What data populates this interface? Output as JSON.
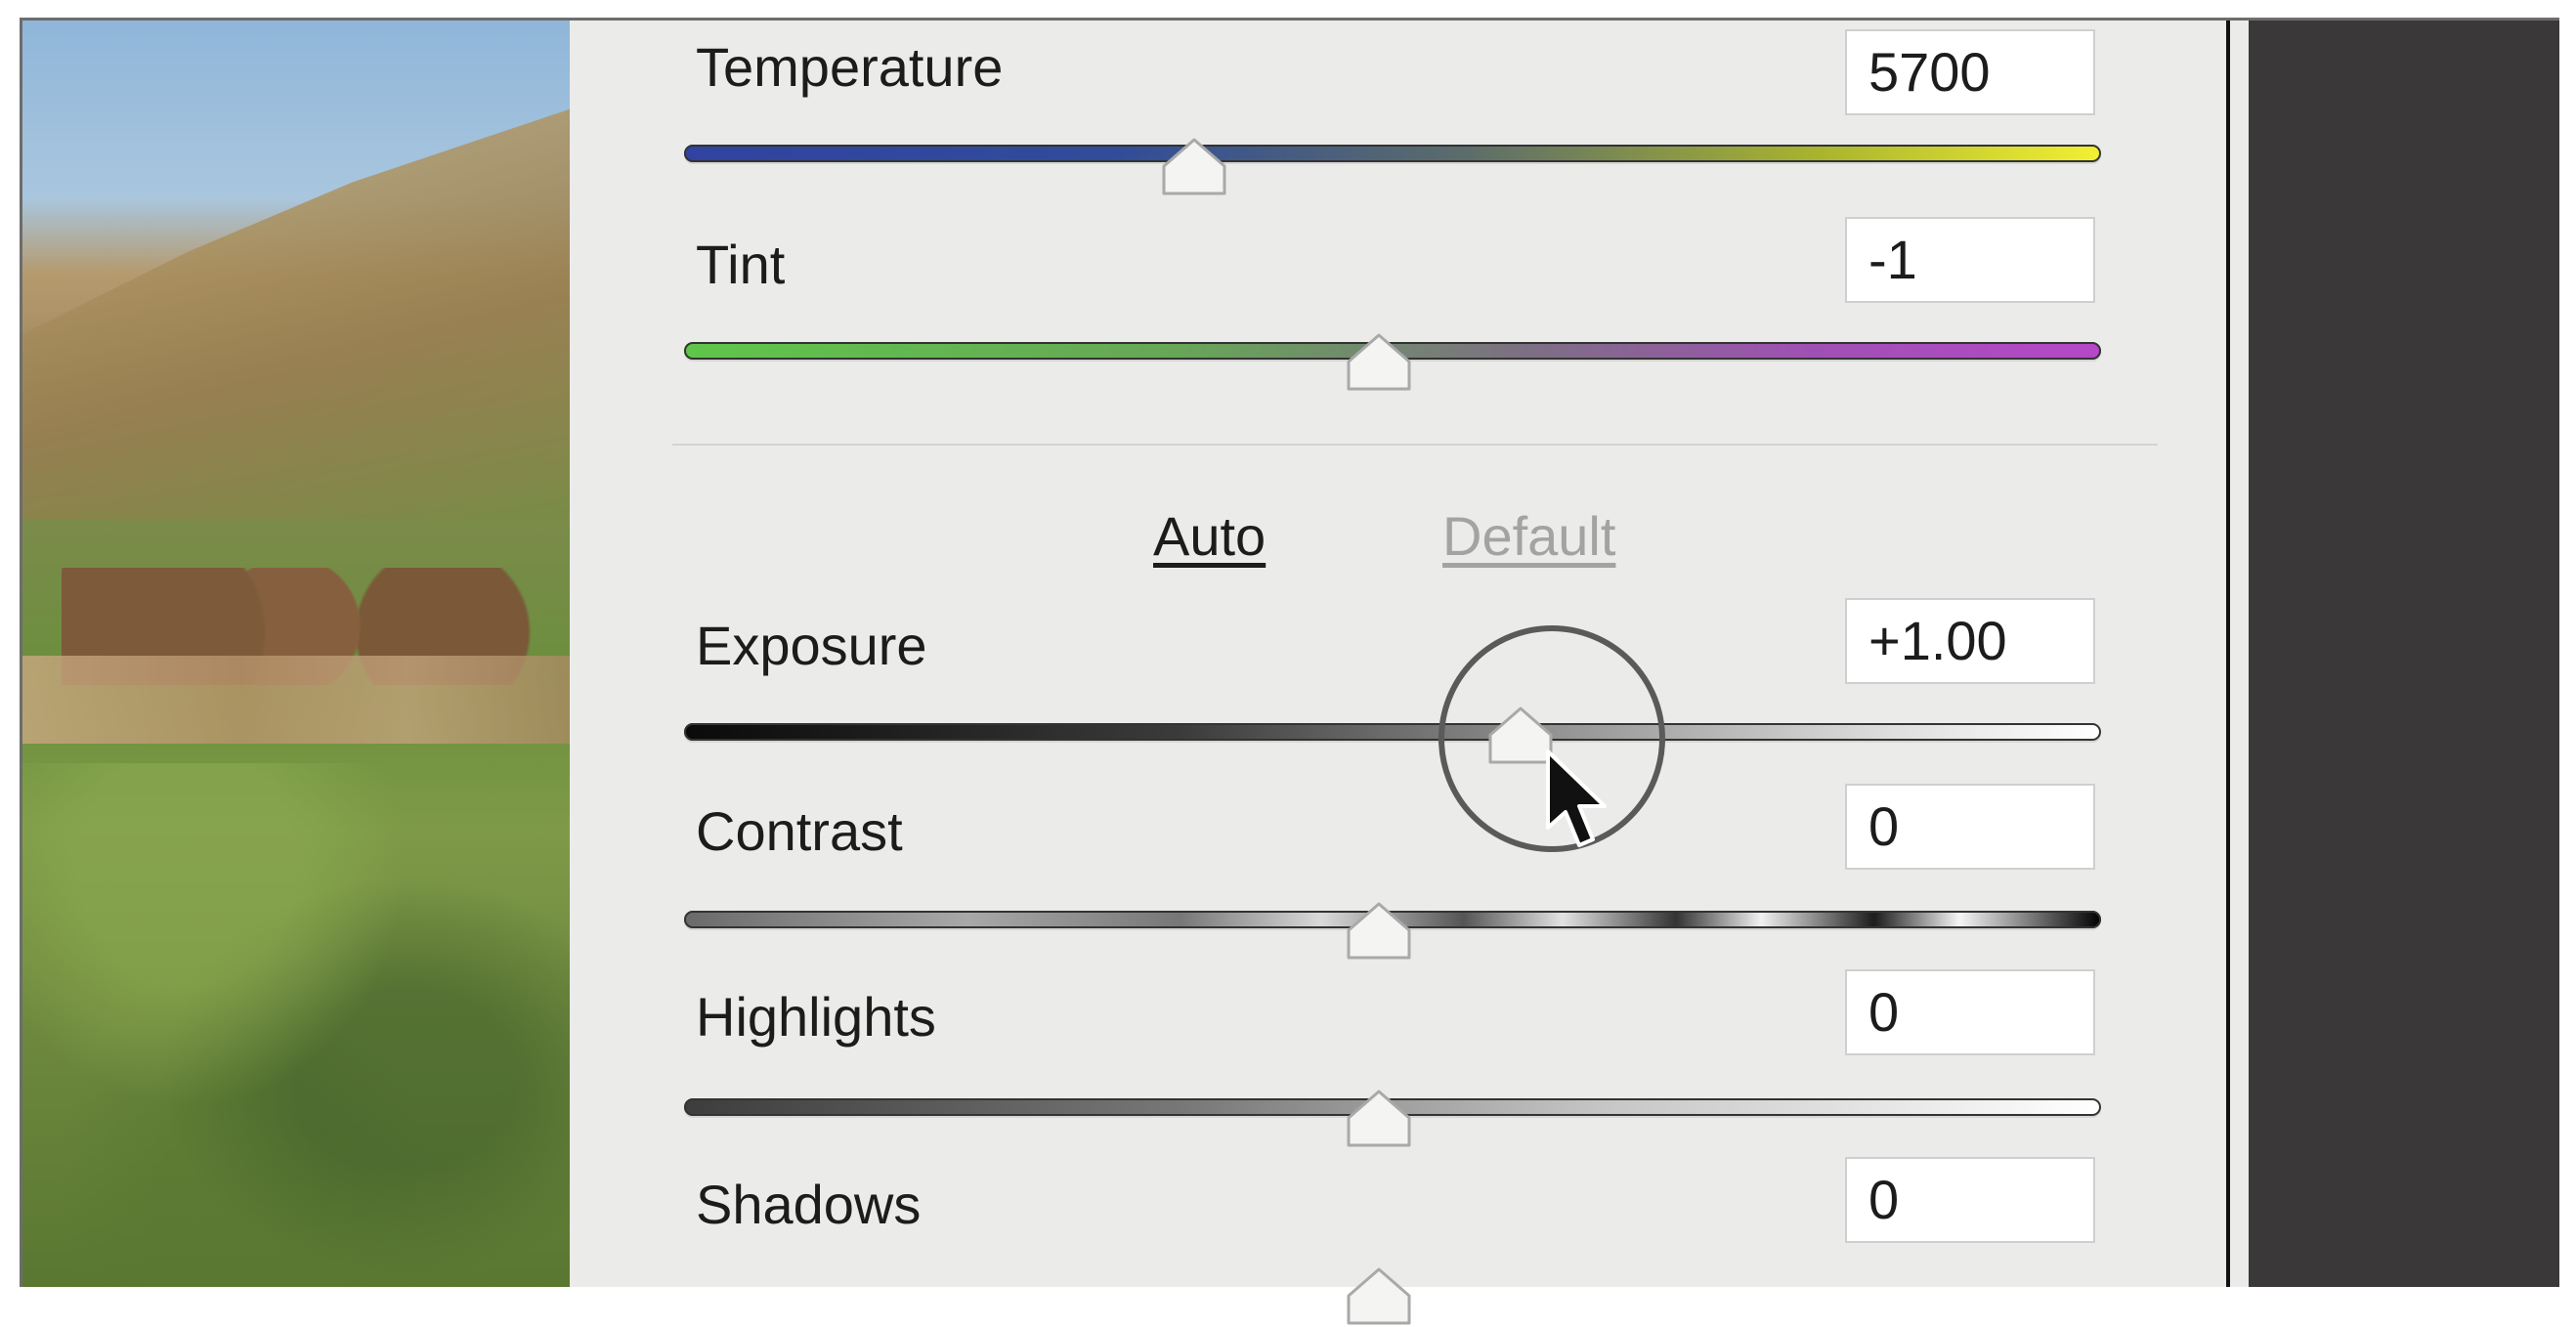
{
  "panel": {
    "temperature": {
      "label": "Temperature",
      "value": "5700",
      "slider_position": 0.36
    },
    "tint": {
      "label": "Tint",
      "value": "-1",
      "slider_position": 0.49
    },
    "buttons": {
      "auto": "Auto",
      "default": "Default"
    },
    "exposure": {
      "label": "Exposure",
      "value": "+1.00",
      "slider_position": 0.59
    },
    "contrast": {
      "label": "Contrast",
      "value": "0",
      "slider_position": 0.49
    },
    "highlights": {
      "label": "Highlights",
      "value": "0",
      "slider_position": 0.49
    },
    "shadows": {
      "label": "Shadows",
      "value": "0",
      "slider_position": 0.49
    }
  },
  "icons": [
    "slider-thumb-icon",
    "mouse-pointer-icon",
    "cursor-highlight-ring"
  ],
  "colors": {
    "panel_bg": "#ebebea",
    "dark_side": "#3a3839",
    "default_link": "#a3a3a3"
  }
}
